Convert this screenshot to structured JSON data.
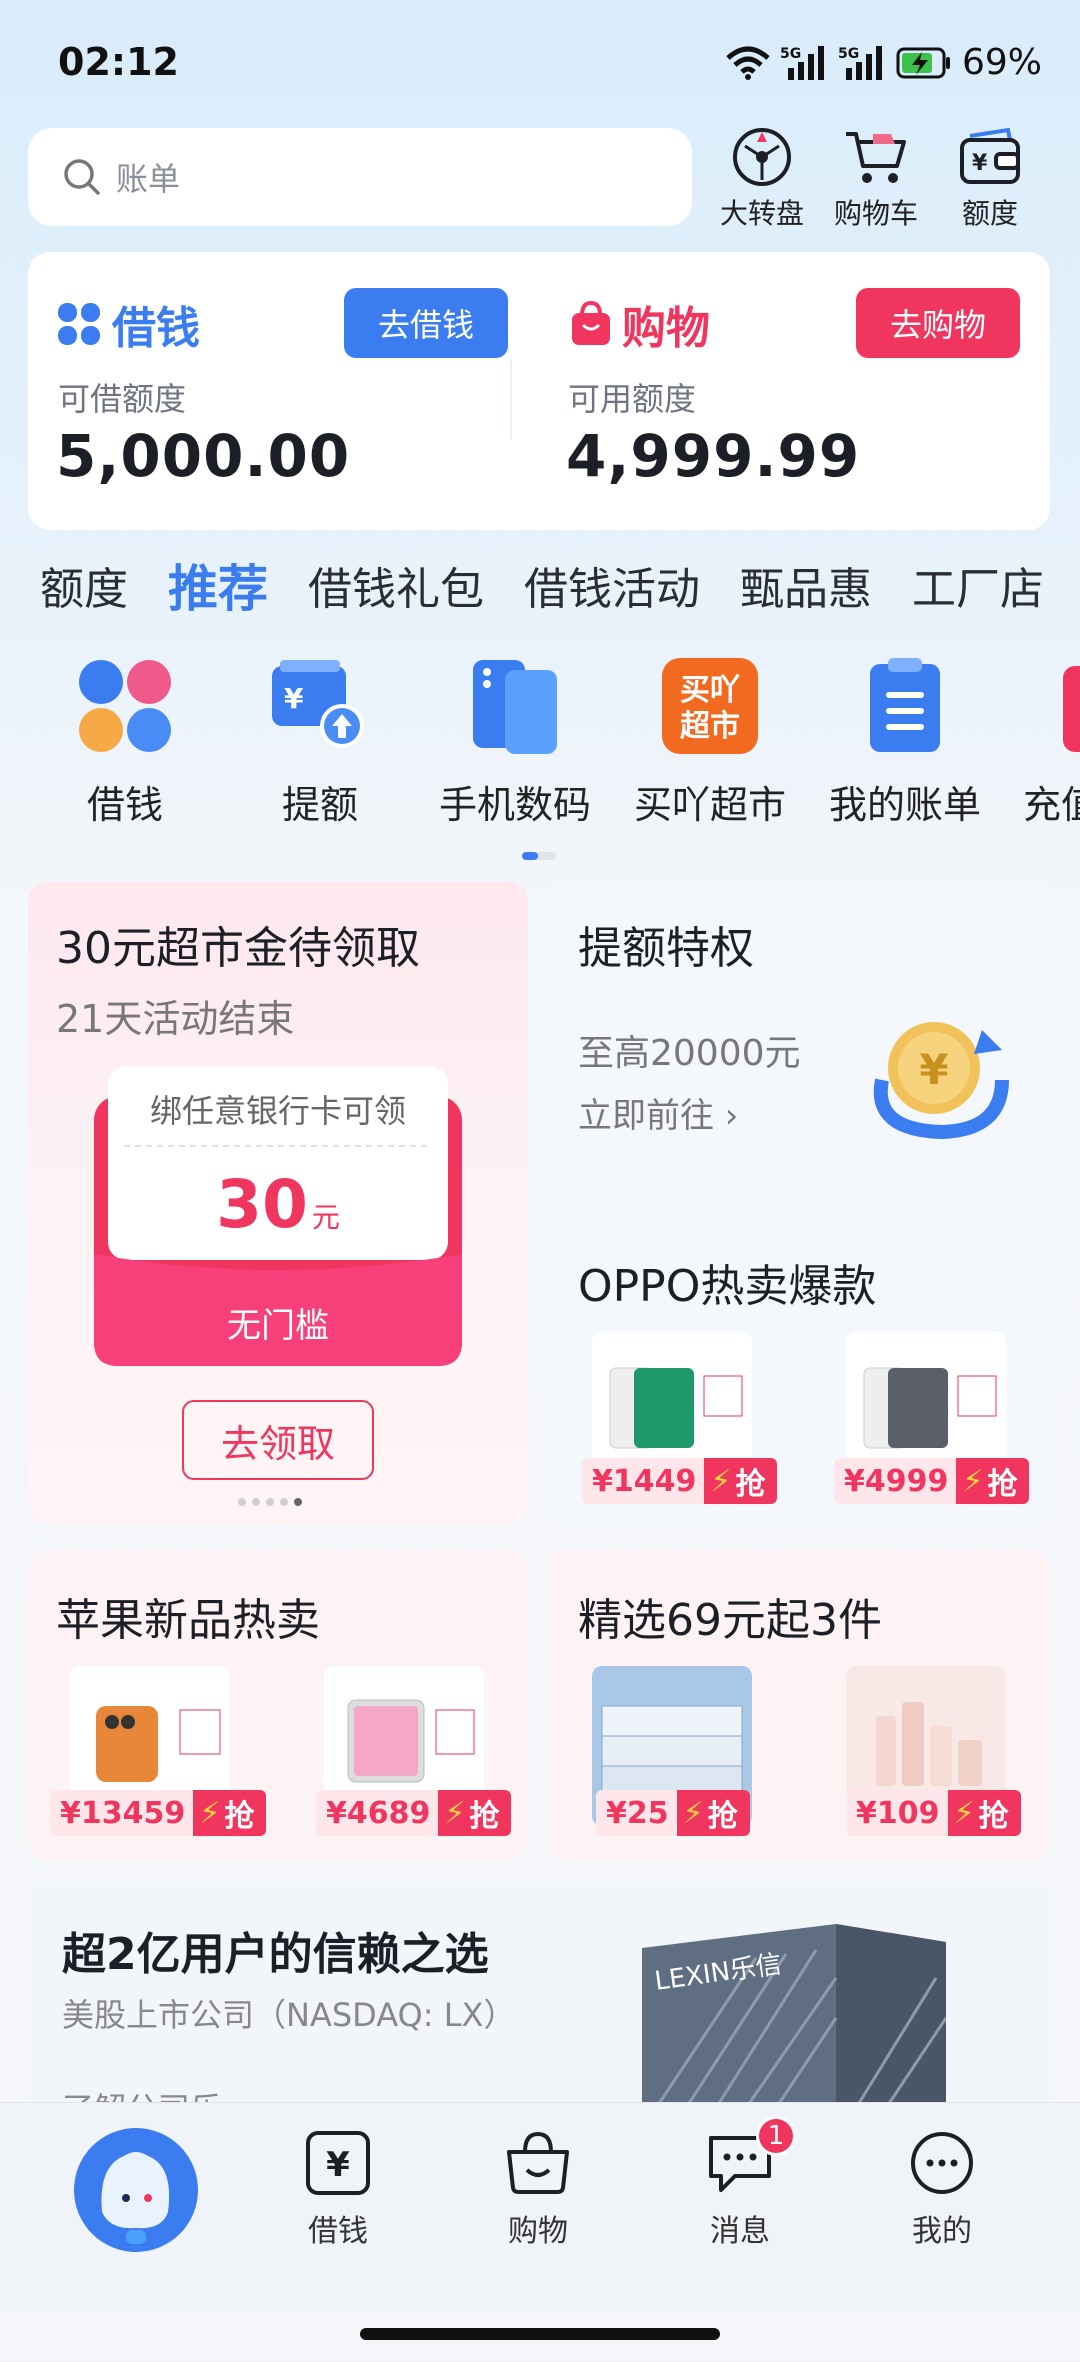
{
  "status": {
    "time": "02:12",
    "battery": "69%"
  },
  "search": {
    "placeholder": "账单"
  },
  "top_icons": [
    {
      "label": "大转盘",
      "icon": "wheel-icon"
    },
    {
      "label": "购物车",
      "icon": "cart-icon"
    },
    {
      "label": "额度",
      "icon": "wallet-icon"
    }
  ],
  "borrow": {
    "title": "借钱",
    "button": "去借钱",
    "sub": "可借额度",
    "amount": "5,000.00"
  },
  "shop": {
    "title": "购物",
    "button": "去购物",
    "sub": "可用额度",
    "amount": "4,999.99"
  },
  "tabs": [
    "额度",
    "推荐",
    "借钱礼包",
    "借钱活动",
    "甄品惠",
    "工厂店"
  ],
  "quick": [
    {
      "label": "借钱",
      "icon": "clover-icon"
    },
    {
      "label": "提额",
      "icon": "limit-up-icon"
    },
    {
      "label": "手机数码",
      "icon": "phone-icon"
    },
    {
      "label": "买吖超市",
      "icon": "supermarket-icon",
      "badge": "买吖\n超市"
    },
    {
      "label": "我的账单",
      "icon": "bill-icon"
    },
    {
      "label": "充值",
      "icon": "recharge-icon"
    }
  ],
  "coupon_tile": {
    "title": "30元超市金待领取",
    "sub": "21天活动结束",
    "card_top": "绑任意银行卡可领",
    "value": "30",
    "unit": "元",
    "bottom": "无门槛",
    "button": "去领取"
  },
  "limit_tile": {
    "title": "提额特权",
    "line1": "至高20000元",
    "line2": "立即前往 ›"
  },
  "oppo_tile": {
    "title": "OPPO热卖爆款",
    "prices": [
      "¥1449",
      "¥4999"
    ],
    "grab": "抢"
  },
  "apple_tile": {
    "title": "苹果新品热卖",
    "prices": [
      "¥13459",
      "¥4689"
    ],
    "grab": "抢"
  },
  "select_tile": {
    "title": "精选69元起3件",
    "prices": [
      "¥25",
      "¥109"
    ],
    "grab": "抢"
  },
  "trust": {
    "title": "超2亿用户的信赖之选",
    "sub": "美股上市公司（NASDAQ: LX）",
    "link": "了解公司乐 ›",
    "building": "LEXIN乐信"
  },
  "nav": [
    {
      "label": "",
      "icon": "mascot-icon"
    },
    {
      "label": "借钱",
      "icon": "yen-icon"
    },
    {
      "label": "购物",
      "icon": "bag-icon"
    },
    {
      "label": "消息",
      "icon": "chat-icon",
      "badge": "1"
    },
    {
      "label": "我的",
      "icon": "more-icon"
    }
  ],
  "colors": {
    "blue": "#3b7cf0",
    "pink": "#f0365f"
  }
}
